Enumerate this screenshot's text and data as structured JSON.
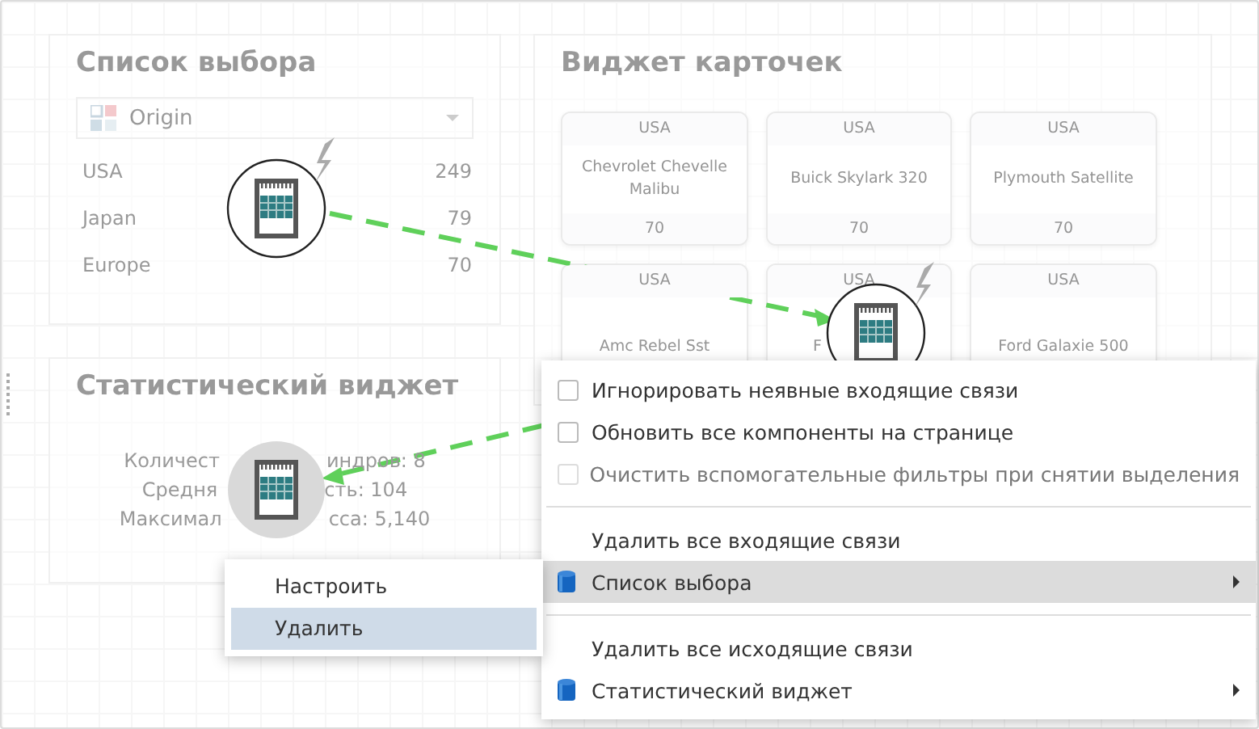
{
  "widgets": [
    {
      "kind": "list",
      "title": "Список выбора",
      "dropdown": {
        "value": "Origin"
      },
      "rows": [
        {
          "label": "USA",
          "value": "249"
        },
        {
          "label": "Japan",
          "value": "79"
        },
        {
          "label": "Europe",
          "value": "70"
        }
      ]
    },
    {
      "kind": "cards",
      "title": "Виджет карточек",
      "cards": [
        {
          "header": "USA",
          "body": "Chevrolet Chevelle Malibu",
          "footer": "70"
        },
        {
          "header": "USA",
          "body": "Buick Skylark 320",
          "footer": "70"
        },
        {
          "header": "USA",
          "body": "Plymouth Satellite",
          "footer": "70"
        },
        {
          "header": "USA",
          "body": "Amc Rebel Sst"
        },
        {
          "header": "USA",
          "body": "F"
        },
        {
          "header": "USA",
          "body": "Ford Galaxie 500"
        }
      ]
    },
    {
      "kind": "stats",
      "title": "Статистический виджет",
      "lines": [
        [
          "Количест",
          "индров: 8"
        ],
        [
          "Средня",
          "сть: 104"
        ],
        [
          "Максимал",
          "сса: 5,140"
        ]
      ]
    }
  ],
  "nodes": [
    {
      "kind": "lightning"
    },
    {
      "kind": "lightning"
    },
    {
      "kind": "shaded"
    }
  ],
  "context_menu": [
    {
      "kind": "checkbox",
      "label": "Игнорировать неявные входящие связи",
      "checked": false,
      "disabled": false
    },
    {
      "kind": "checkbox",
      "label": "Обновить все компоненты на странице",
      "checked": false,
      "disabled": false
    },
    {
      "kind": "checkbox",
      "label": "Очистить вспомогательные фильтры при снятии выделения",
      "checked": false,
      "disabled": true
    },
    {
      "kind": "separator"
    },
    {
      "kind": "action",
      "label": "Удалить все входящие связи"
    },
    {
      "kind": "submenu",
      "label": "Список выбора",
      "selected": true
    },
    {
      "kind": "separator"
    },
    {
      "kind": "action",
      "label": "Удалить все исходящие связи"
    },
    {
      "kind": "submenu",
      "label": "Статистический виджет",
      "selected": false
    }
  ],
  "node_menu": [
    {
      "label": "Настроить",
      "selected": false
    },
    {
      "label": "Удалить",
      "selected": true
    }
  ]
}
